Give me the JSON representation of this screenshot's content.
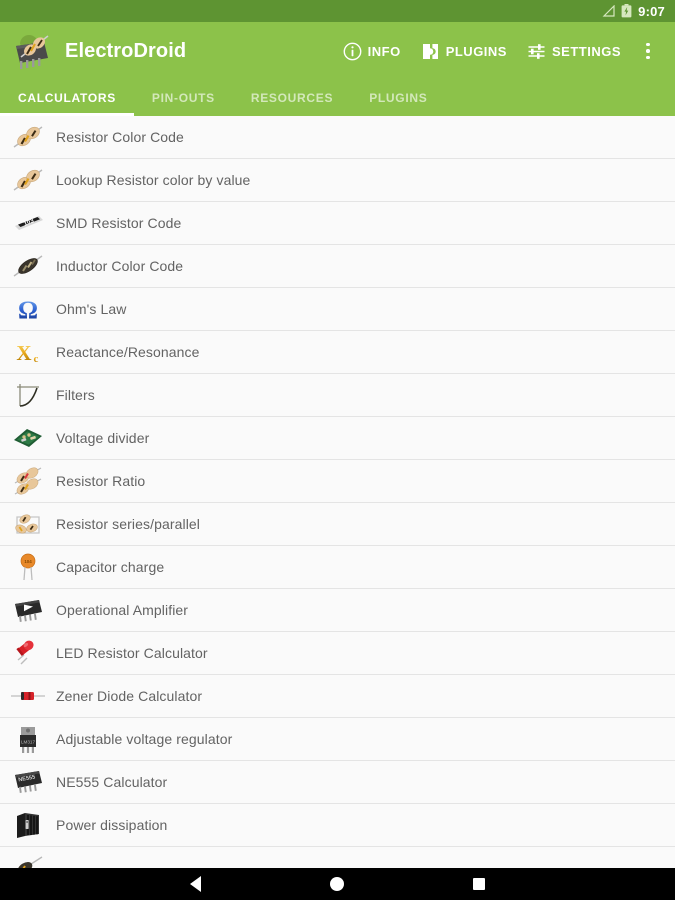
{
  "status_bar": {
    "time": "9:07",
    "signal_icon": "signal-triangle-icon",
    "battery_icon": "battery-charging-icon",
    "background": "#5e9432"
  },
  "toolbar": {
    "app_title": "ElectroDroid",
    "logo_icon": "electrodroid-logo-icon",
    "background": "#8cc24a",
    "actions": [
      {
        "label": "INFO",
        "icon": "info-circle-icon"
      },
      {
        "label": "PLUGINS",
        "icon": "plugin-puzzle-icon"
      },
      {
        "label": "SETTINGS",
        "icon": "settings-sliders-icon"
      }
    ],
    "overflow_icon": "overflow-menu-icon"
  },
  "tabs": {
    "active_index": 0,
    "items": [
      {
        "label": "CALCULATORS"
      },
      {
        "label": "PIN-OUTS"
      },
      {
        "label": "RESOURCES"
      },
      {
        "label": "PLUGINS"
      }
    ]
  },
  "list": {
    "background": "#fafafa",
    "divider_color": "#e4e4e4",
    "text_color": "#636363",
    "items": [
      {
        "label": "Resistor Color Code",
        "icon": "resistor-color-code-icon"
      },
      {
        "label": "Lookup Resistor color by value",
        "icon": "resistor-lookup-icon"
      },
      {
        "label": "SMD Resistor Code",
        "icon": "smd-resistor-icon",
        "code": "103"
      },
      {
        "label": "Inductor Color Code",
        "icon": "inductor-icon"
      },
      {
        "label": "Ohm's Law",
        "icon": "ohm-symbol-icon",
        "symbol": "Ω"
      },
      {
        "label": "Reactance/Resonance",
        "icon": "reactance-xc-icon",
        "symbol": "X"
      },
      {
        "label": "Filters",
        "icon": "filter-curve-icon"
      },
      {
        "label": "Voltage divider",
        "icon": "pcb-board-icon"
      },
      {
        "label": "Resistor Ratio",
        "icon": "resistor-ratio-icon"
      },
      {
        "label": "Resistor series/parallel",
        "icon": "resistor-network-icon"
      },
      {
        "label": "Capacitor charge",
        "icon": "capacitor-icon"
      },
      {
        "label": "Operational Amplifier",
        "icon": "opamp-chip-icon"
      },
      {
        "label": "LED Resistor Calculator",
        "icon": "led-icon"
      },
      {
        "label": "Zener Diode Calculator",
        "icon": "zener-diode-icon"
      },
      {
        "label": "Adjustable voltage regulator",
        "icon": "voltage-regulator-icon"
      },
      {
        "label": "NE555 Calculator",
        "icon": "ne555-chip-icon",
        "code": "NE555"
      },
      {
        "label": "Power dissipation",
        "icon": "heatsink-icon"
      },
      {
        "label": "",
        "icon": "resistor-partial-icon"
      }
    ]
  },
  "navigation_bar": {
    "background": "#000000",
    "buttons": [
      {
        "name": "back",
        "icon": "back-triangle-icon"
      },
      {
        "name": "home",
        "icon": "home-circle-icon"
      },
      {
        "name": "recents",
        "icon": "recents-square-icon"
      }
    ]
  }
}
